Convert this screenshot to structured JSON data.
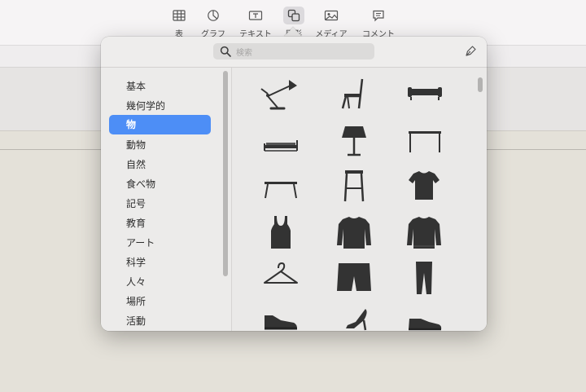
{
  "toolbar": {
    "items": [
      {
        "label": "表",
        "icon": "table-icon"
      },
      {
        "label": "グラフ",
        "icon": "chart-icon"
      },
      {
        "label": "テキスト",
        "icon": "text-box-icon"
      },
      {
        "label": "図形",
        "icon": "shapes-icon",
        "active": true
      },
      {
        "label": "メディア",
        "icon": "media-icon"
      },
      {
        "label": "コメント",
        "icon": "comment-icon"
      }
    ]
  },
  "popover": {
    "search_placeholder": "検索",
    "categories": [
      "基本",
      "幾何学的",
      "物",
      "動物",
      "自然",
      "食べ物",
      "記号",
      "教育",
      "アート",
      "科学",
      "人々",
      "場所",
      "活動"
    ],
    "selected_category": "物",
    "shapes": [
      "desk-lamp-icon",
      "chair-icon",
      "sofa-icon",
      "bed-icon",
      "floor-lamp-icon",
      "table-icon",
      "coffee-table-icon",
      "stool-icon",
      "t-shirt-icon",
      "tank-top-icon",
      "sweater-icon",
      "long-sleeve-shirt-icon",
      "hanger-icon",
      "shorts-icon",
      "pants-icon",
      "sneaker-icon",
      "high-heel-icon",
      "dress-shoe-icon"
    ]
  }
}
